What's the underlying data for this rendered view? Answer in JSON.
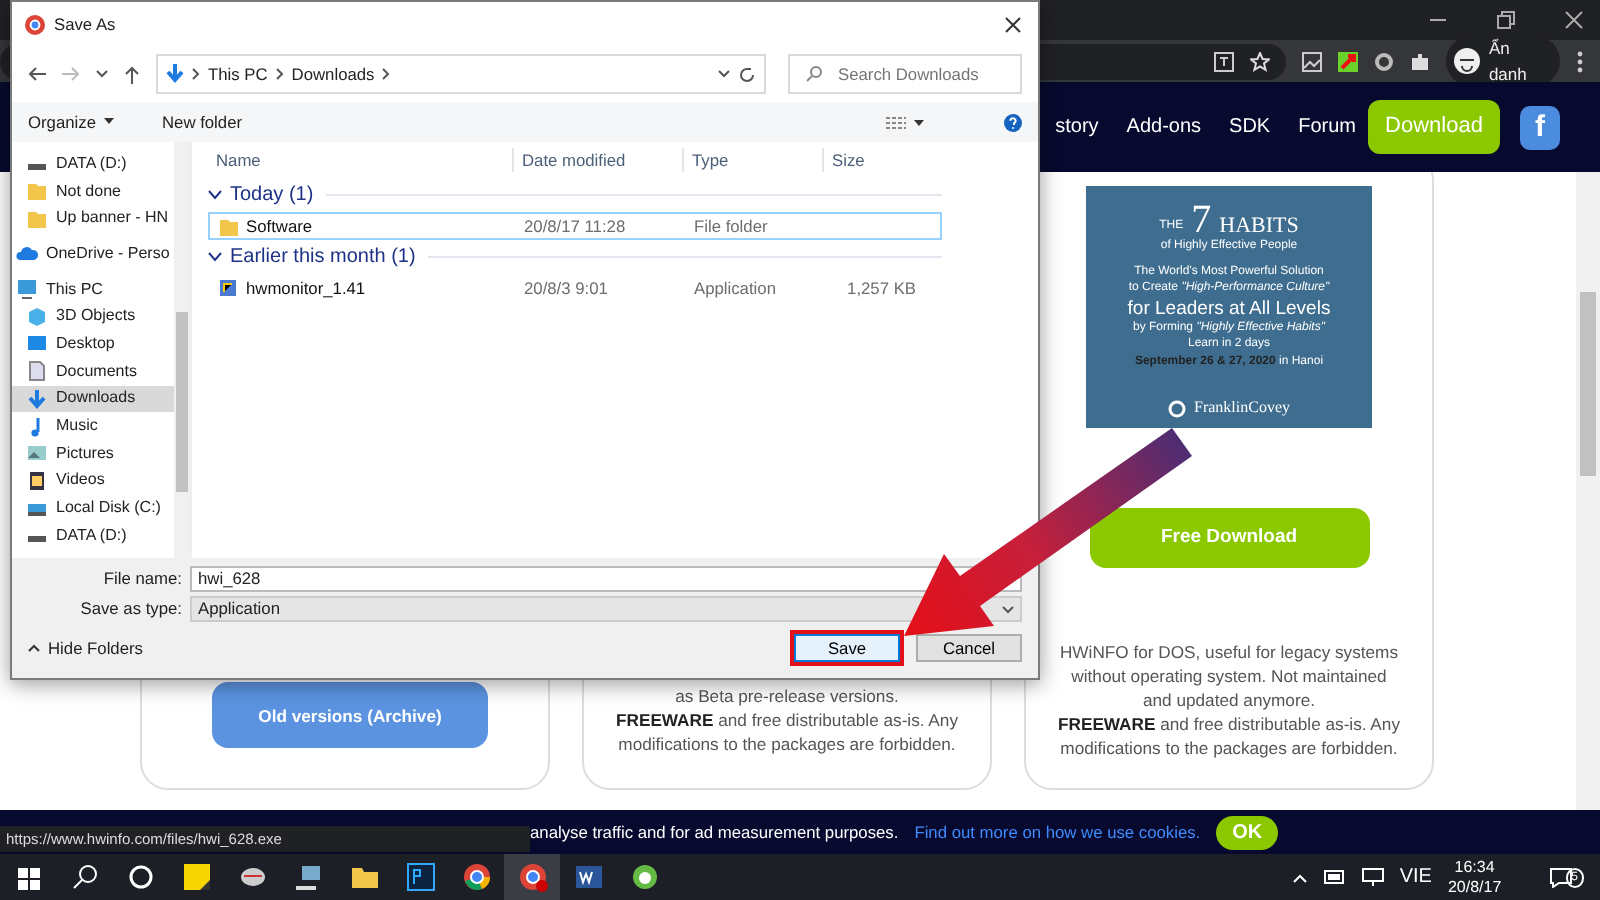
{
  "browser": {
    "incognito_label": "Ẩn danh"
  },
  "site_nav": {
    "items": [
      "story",
      "Add-ons",
      "SDK",
      "Forum"
    ],
    "download_button": "Download",
    "facebook_button": "f"
  },
  "ad": {
    "logo_the": "THE",
    "logo_number": "7",
    "logo_habits": "HABITS",
    "logo_tagline": "of Highly Effective People",
    "lines": [
      "The World's Most Powerful Solution",
      "to Create *\"High-Performance Culture\"*",
      "for Leaders at All Levels",
      "by Forming *\"Highly Effective Habits\"*",
      "Learn in 2 days",
      "**September 26 & 27, 2020** in Hanoi"
    ],
    "brand": "FranklinCovey"
  },
  "archive_button": "Old versions (Archive)",
  "middle_card": {
    "lines": [
      "as Beta pre-release versions.",
      "**FREEWARE** and free distributable as-is. Any modifications to the packages are forbidden."
    ]
  },
  "right_card": {
    "button": "Free Download",
    "description": "HWiNFO for DOS, useful for legacy systems without operating system. Not maintained and updated anymore.",
    "license": "**FREEWARE** and free distributable as-is. Any modifications to the packages are forbidden."
  },
  "cookie_bar": {
    "text": "analyse traffic and for ad measurement purposes.",
    "link": "Find out more on how we use cookies.",
    "ok_button": "OK"
  },
  "status_url": "https://www.hwinfo.com/files/hwi_628.exe",
  "dialog": {
    "title": "Save As",
    "breadcrumb": [
      "This PC",
      "Downloads"
    ],
    "search_placeholder": "Search Downloads",
    "toolbar": [
      "Organize",
      "New folder"
    ],
    "sidebar": [
      {
        "label": "DATA (D:)",
        "selected": false
      },
      {
        "label": "Not done",
        "selected": false
      },
      {
        "label": "Up banner - HN",
        "selected": false
      },
      {
        "label": "OneDrive - Perso",
        "selected": false
      },
      {
        "label": "This PC",
        "selected": false
      },
      {
        "label": "3D Objects",
        "selected": false
      },
      {
        "label": "Desktop",
        "selected": false
      },
      {
        "label": "Documents",
        "selected": false
      },
      {
        "label": "Downloads",
        "selected": true
      },
      {
        "label": "Music",
        "selected": false
      },
      {
        "label": "Pictures",
        "selected": false
      },
      {
        "label": "Videos",
        "selected": false
      },
      {
        "label": "Local Disk (C:)",
        "selected": false
      },
      {
        "label": "DATA (D:)",
        "selected": false
      }
    ],
    "columns": [
      "Name",
      "Date modified",
      "Type",
      "Size"
    ],
    "groups": [
      {
        "title": "Today (1)",
        "rows": [
          {
            "name": "Software",
            "date": "20/8/17 11:28",
            "type": "File folder",
            "selected": true
          }
        ]
      },
      {
        "title": "Earlier this month (1)",
        "rows": [
          {
            "name": "hwmonitor_1.41",
            "date": "20/8/3 9:01",
            "type": "Application",
            "size": "1,257 KB",
            "selected": false
          }
        ]
      }
    ],
    "file_name_label": "File name:",
    "file_name": "hwi_628",
    "type_label": "Save as type:",
    "type_value": "Application",
    "hide_folders": "Hide Folders",
    "buttons": [
      {
        "label": "Save",
        "highlighted": true
      },
      {
        "label": "Cancel",
        "highlighted": false
      }
    ]
  },
  "taskbar": {
    "language": "VIE",
    "time": "16:34",
    "date": "20/8/17",
    "notification_count": "5"
  }
}
